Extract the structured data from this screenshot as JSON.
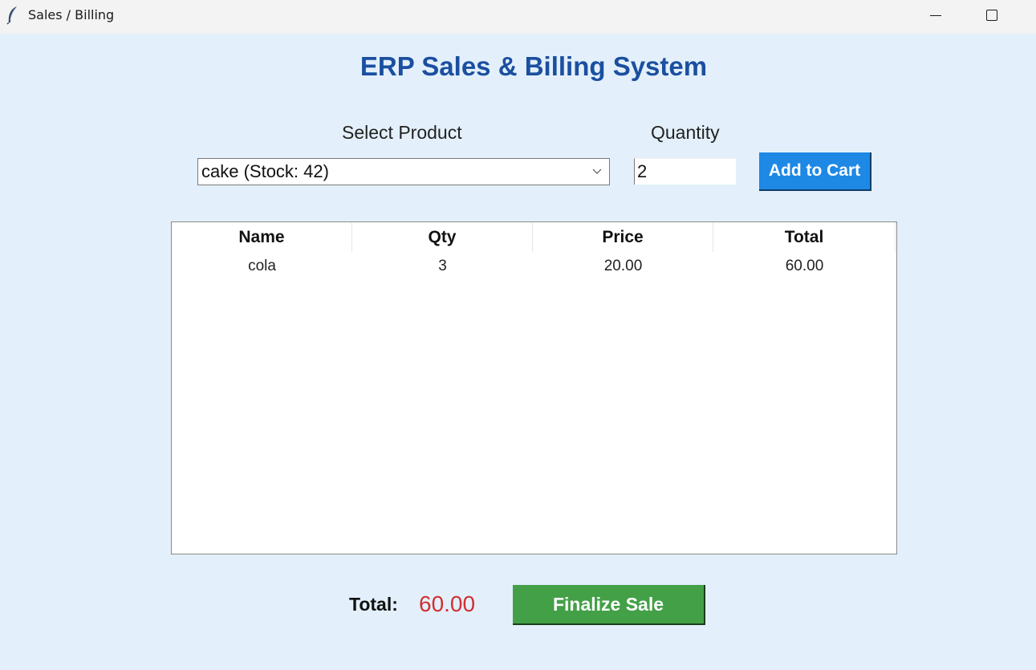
{
  "window": {
    "title": "Sales / Billing",
    "icon": "feather-icon",
    "controls": [
      "minimize-icon",
      "maximize-icon"
    ]
  },
  "header": {
    "title": "ERP Sales & Billing System"
  },
  "form": {
    "product_label": "Select Product",
    "product_selected": "cake (Stock: 42)",
    "quantity_label": "Quantity",
    "quantity_value": "2",
    "add_button": "Add to Cart"
  },
  "cart": {
    "columns": [
      "Name",
      "Qty",
      "Price",
      "Total"
    ],
    "rows": [
      [
        "cola",
        "3",
        "20.00",
        "60.00"
      ]
    ]
  },
  "footer": {
    "total_label": "Total:",
    "total_value": "60.00",
    "finalize_button": "Finalize Sale"
  },
  "colors": {
    "background": "#e3f0fb",
    "title": "#1b4fa0",
    "add_button": "#1e88e5",
    "finalize_button": "#43a047",
    "total_value": "#d32f2f"
  }
}
